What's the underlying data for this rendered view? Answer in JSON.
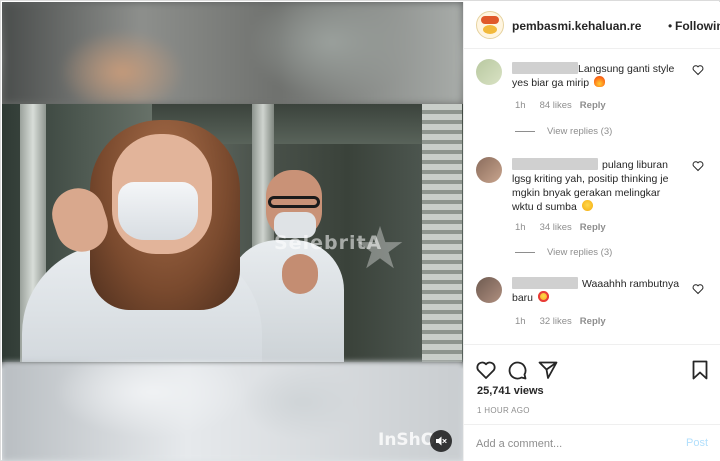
{
  "post": {
    "username": "pembasmi.kehaluan.re",
    "separator": "•",
    "follow_status": "Following"
  },
  "media": {
    "watermark": "SelebritA",
    "app_watermark": "InShO"
  },
  "comments": [
    {
      "text": "Langsung ganti style yes biar ga mirip",
      "time": "1h",
      "likes": "84 likes",
      "reply": "Reply",
      "view_replies": "View replies (3)"
    },
    {
      "text": "pulang liburan lgsg kriting yah, positip thinking je mgkin bnyak gerakan melingkar wktu d sumba",
      "time": "1h",
      "likes": "34 likes",
      "reply": "Reply",
      "view_replies": "View replies (3)"
    },
    {
      "text": "Waaahhh rambutnya baru",
      "time": "1h",
      "likes": "32 likes",
      "reply": "Reply"
    }
  ],
  "actions": {
    "views": "25,741 views",
    "time_ago": "1 HOUR AGO",
    "add_comment_placeholder": "Add a comment...",
    "post_label": "Post"
  },
  "colors": {
    "post_button_disabled": "#b2dffc",
    "secondary_text": "#8e8e8e"
  }
}
